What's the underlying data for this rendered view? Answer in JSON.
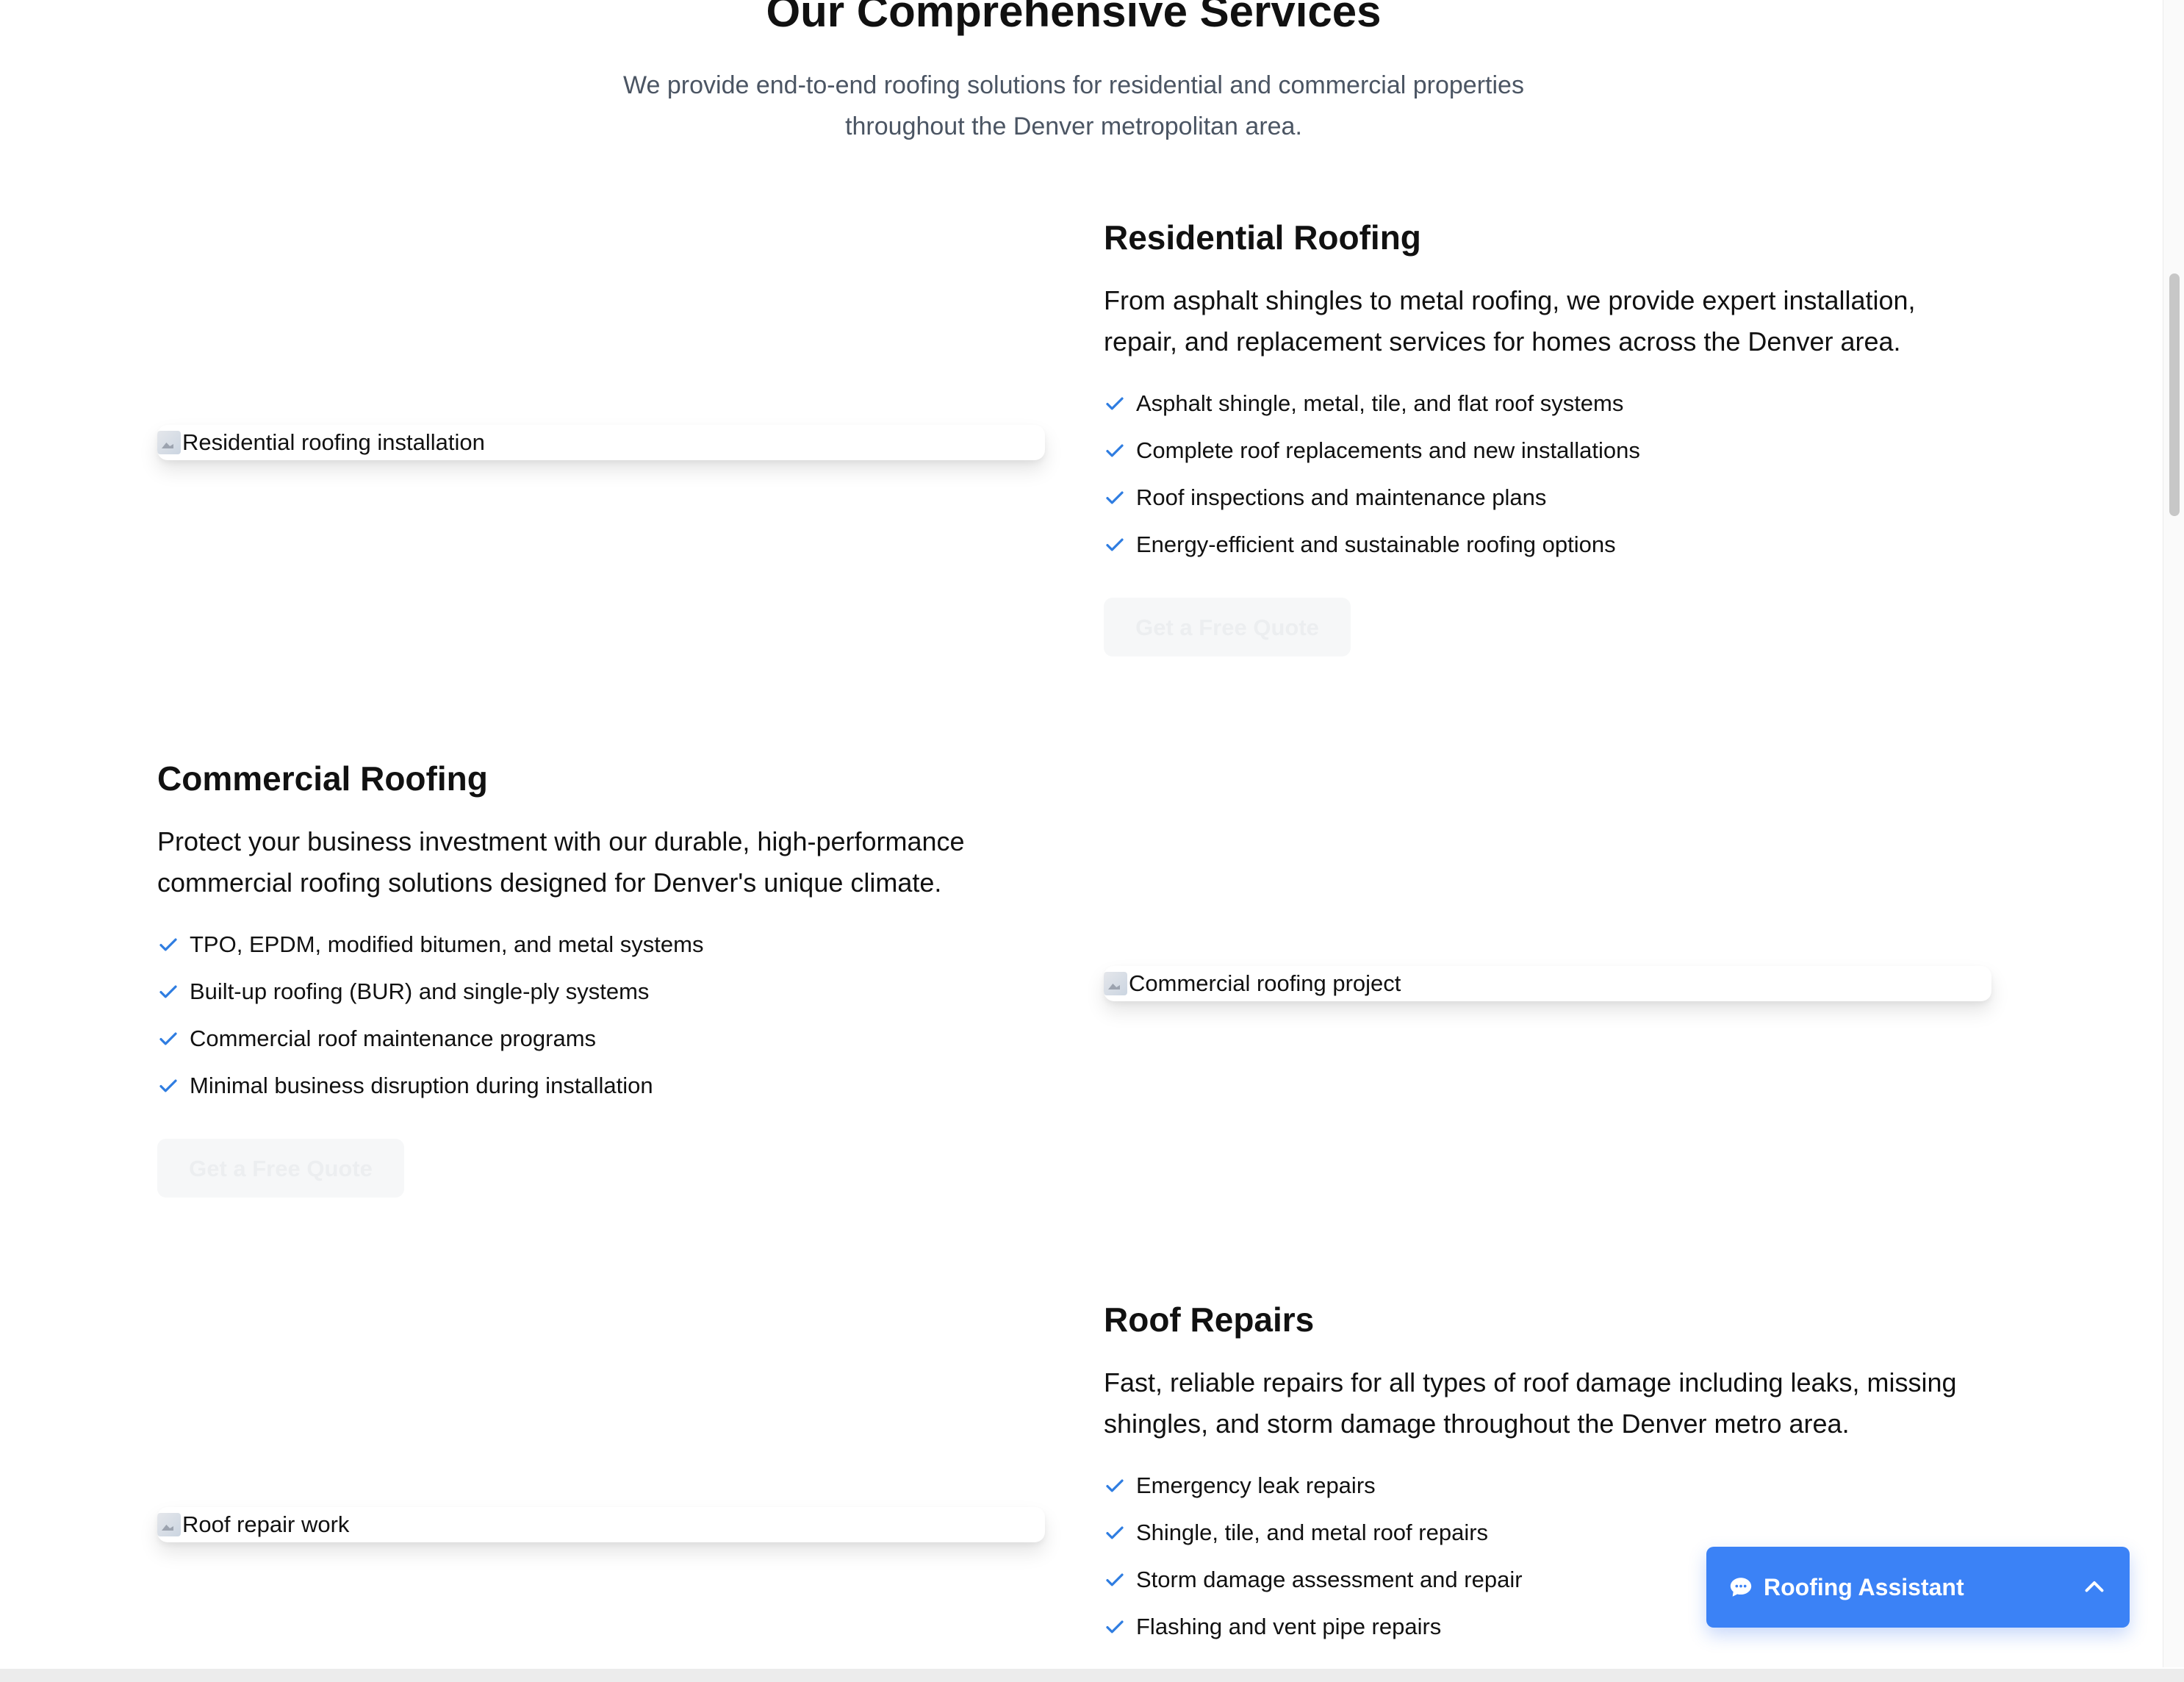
{
  "header": {
    "title": "Our Comprehensive Services",
    "subtitle": "We provide end-to-end roofing solutions for residential and commercial properties throughout the Denver metropolitan area."
  },
  "services": [
    {
      "title": "Residential Roofing",
      "description": "From asphalt shingles to metal roofing, we provide expert installation, repair, and replacement services for homes across the Denver area.",
      "features": [
        "Asphalt shingle, metal, tile, and flat roof systems",
        "Complete roof replacements and new installations",
        "Roof inspections and maintenance plans",
        "Energy-efficient and sustainable roofing options"
      ],
      "button": "Get a Free Quote",
      "image_alt": "Residential roofing installation"
    },
    {
      "title": "Commercial Roofing",
      "description": "Protect your business investment with our durable, high-performance commercial roofing solutions designed for Denver's unique climate.",
      "features": [
        "TPO, EPDM, modified bitumen, and metal systems",
        "Built-up roofing (BUR) and single-ply systems",
        "Commercial roof maintenance programs",
        "Minimal business disruption during installation"
      ],
      "button": "Get a Free Quote",
      "image_alt": "Commercial roofing project"
    },
    {
      "title": "Roof Repairs",
      "description": "Fast, reliable repairs for all types of roof damage including leaks, missing shingles, and storm damage throughout the Denver metro area.",
      "features": [
        "Emergency leak repairs",
        "Shingle, tile, and metal roof repairs",
        "Storm damage assessment and repair",
        "Flashing and vent pipe repairs"
      ],
      "image_alt": "Roof repair work"
    }
  ],
  "chat": {
    "label": "Roofing Assistant",
    "icon": "chat-bubble-icon",
    "toggle_icon": "chevron-up-icon"
  },
  "colors": {
    "accent": "#3b82f6",
    "check": "#2f7de1",
    "subtitle_text": "#4b5563"
  }
}
